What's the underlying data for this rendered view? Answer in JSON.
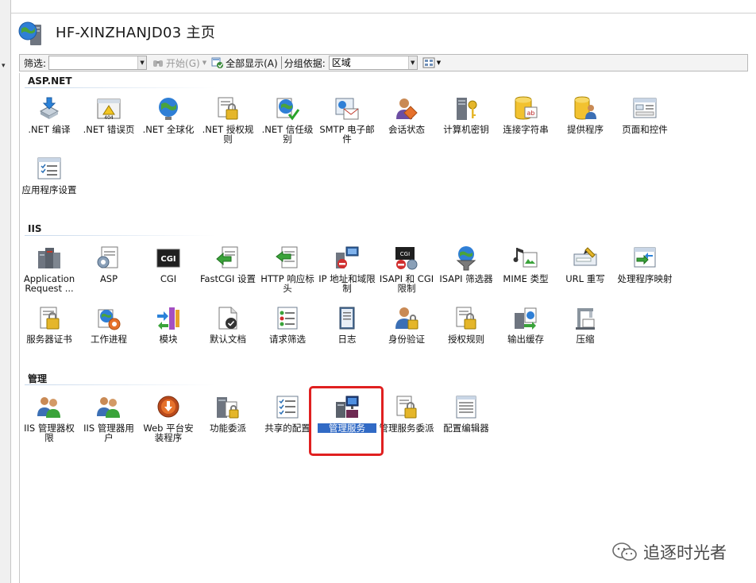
{
  "window": {
    "title": "HF-XINZHANJD03 主页"
  },
  "toolbar": {
    "filter_label": "筛选:",
    "filter_value": "",
    "start_label": "开始(G)",
    "show_all_label": "全部显示(A)",
    "group_by_label": "分组依据:",
    "group_by_value": "区域"
  },
  "groups": {
    "aspnet": {
      "title": "ASP.NET",
      "items": [
        {
          "label": ".NET 编译",
          "icon": "dotnet-compile-icon"
        },
        {
          "label": ".NET 错误页",
          "icon": "error-page-icon"
        },
        {
          "label": ".NET 全球化",
          "icon": "globalization-icon"
        },
        {
          "label": ".NET 授权规则",
          "icon": "authorization-lock-icon"
        },
        {
          "label": ".NET 信任级别",
          "icon": "trust-level-icon"
        },
        {
          "label": "SMTP 电子邮件",
          "icon": "smtp-mail-icon"
        },
        {
          "label": "会话状态",
          "icon": "session-state-icon"
        },
        {
          "label": "计算机密钥",
          "icon": "machine-key-icon"
        },
        {
          "label": "连接字符串",
          "icon": "connection-string-icon"
        },
        {
          "label": "提供程序",
          "icon": "providers-icon"
        },
        {
          "label": "页面和控件",
          "icon": "pages-controls-icon"
        },
        {
          "label": "应用程序设置",
          "icon": "app-settings-icon"
        }
      ]
    },
    "iis": {
      "title": "IIS",
      "items": [
        {
          "label": "Application Request ...",
          "icon": "arr-server-icon"
        },
        {
          "label": "ASP",
          "icon": "asp-icon"
        },
        {
          "label": "CGI",
          "icon": "cgi-icon"
        },
        {
          "label": "FastCGI 设置",
          "icon": "fastcgi-icon"
        },
        {
          "label": "HTTP 响应标头",
          "icon": "http-headers-icon"
        },
        {
          "label": "IP 地址和域限制",
          "icon": "ip-restrictions-icon"
        },
        {
          "label": "ISAPI 和 CGI 限制",
          "icon": "isapi-cgi-icon"
        },
        {
          "label": "ISAPI 筛选器",
          "icon": "isapi-filter-icon"
        },
        {
          "label": "MIME 类型",
          "icon": "mime-types-icon"
        },
        {
          "label": "URL 重写",
          "icon": "url-rewrite-icon"
        },
        {
          "label": "处理程序映射",
          "icon": "handler-mappings-icon"
        },
        {
          "label": "服务器证书",
          "icon": "server-cert-icon"
        },
        {
          "label": "工作进程",
          "icon": "worker-process-icon"
        },
        {
          "label": "模块",
          "icon": "modules-icon"
        },
        {
          "label": "默认文档",
          "icon": "default-document-icon"
        },
        {
          "label": "请求筛选",
          "icon": "request-filtering-icon"
        },
        {
          "label": "日志",
          "icon": "logging-icon"
        },
        {
          "label": "身份验证",
          "icon": "authentication-icon"
        },
        {
          "label": "授权规则",
          "icon": "authorization-rules-icon"
        },
        {
          "label": "输出缓存",
          "icon": "output-cache-icon"
        },
        {
          "label": "压缩",
          "icon": "compression-icon"
        }
      ]
    },
    "management": {
      "title": "管理",
      "items": [
        {
          "label": "IIS 管理器权限",
          "icon": "iis-manager-permissions-icon"
        },
        {
          "label": "IIS 管理器用户",
          "icon": "iis-manager-users-icon"
        },
        {
          "label": "Web 平台安装程序",
          "icon": "web-platform-installer-icon"
        },
        {
          "label": "功能委派",
          "icon": "feature-delegation-icon"
        },
        {
          "label": "共享的配置",
          "icon": "shared-config-icon"
        },
        {
          "label": "管理服务",
          "icon": "management-service-icon"
        },
        {
          "label": "管理服务委派",
          "icon": "management-delegation-icon"
        },
        {
          "label": "配置编辑器",
          "icon": "config-editor-icon"
        }
      ]
    }
  },
  "watermark": {
    "text": "追逐时光者"
  }
}
